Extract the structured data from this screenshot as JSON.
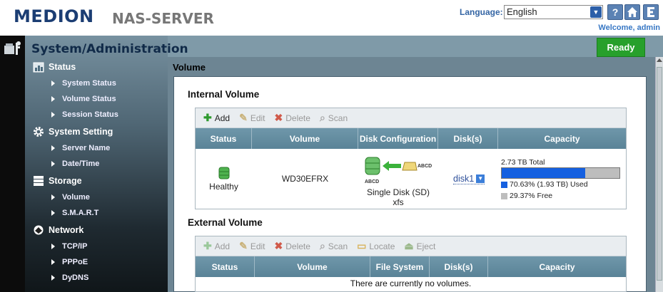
{
  "header": {
    "logo": "MEDION",
    "product": "NAS-SERVER",
    "language_label": "Language:",
    "language_value": "English",
    "help_label": "?",
    "welcome": "Welcome, admin"
  },
  "page": {
    "title": "System/Administration",
    "status": "Ready"
  },
  "sidebar": {
    "status": {
      "label": "Status",
      "items": [
        "System Status",
        "Volume Status",
        "Session Status"
      ]
    },
    "system_setting": {
      "label": "System Setting",
      "items": [
        "Server Name",
        "Date/Time"
      ]
    },
    "storage": {
      "label": "Storage",
      "items": [
        "Volume",
        "S.M.A.R.T"
      ]
    },
    "network": {
      "label": "Network",
      "items": [
        "TCP/IP",
        "PPPoE",
        "DyDNS"
      ]
    }
  },
  "volume": {
    "title": "Volume",
    "internal": {
      "title": "Internal Volume",
      "toolbar": {
        "add": "Add",
        "edit": "Edit",
        "delete": "Delete",
        "scan": "Scan"
      },
      "columns": [
        "Status",
        "Volume",
        "Disk Configuration",
        "Disk(s)",
        "Capacity"
      ],
      "row": {
        "status": "Healthy",
        "volume": "WD30EFRX",
        "disk_label": "ABCD",
        "config": "Single Disk (SD)",
        "fs": "xfs",
        "disk": "disk1",
        "total": "2.73 TB Total",
        "used_pct": 70.63,
        "used": "70.63% (1.93 TB) Used",
        "free": "29.37% Free",
        "used_color": "#1560e0",
        "free_color": "#bdbdbd"
      }
    },
    "external": {
      "title": "External Volume",
      "toolbar": {
        "add": "Add",
        "edit": "Edit",
        "delete": "Delete",
        "scan": "Scan",
        "locate": "Locate",
        "eject": "Eject"
      },
      "columns": [
        "Status",
        "Volume",
        "File System",
        "Disk(s)",
        "Capacity"
      ],
      "empty": "There are currently no volumes."
    }
  }
}
